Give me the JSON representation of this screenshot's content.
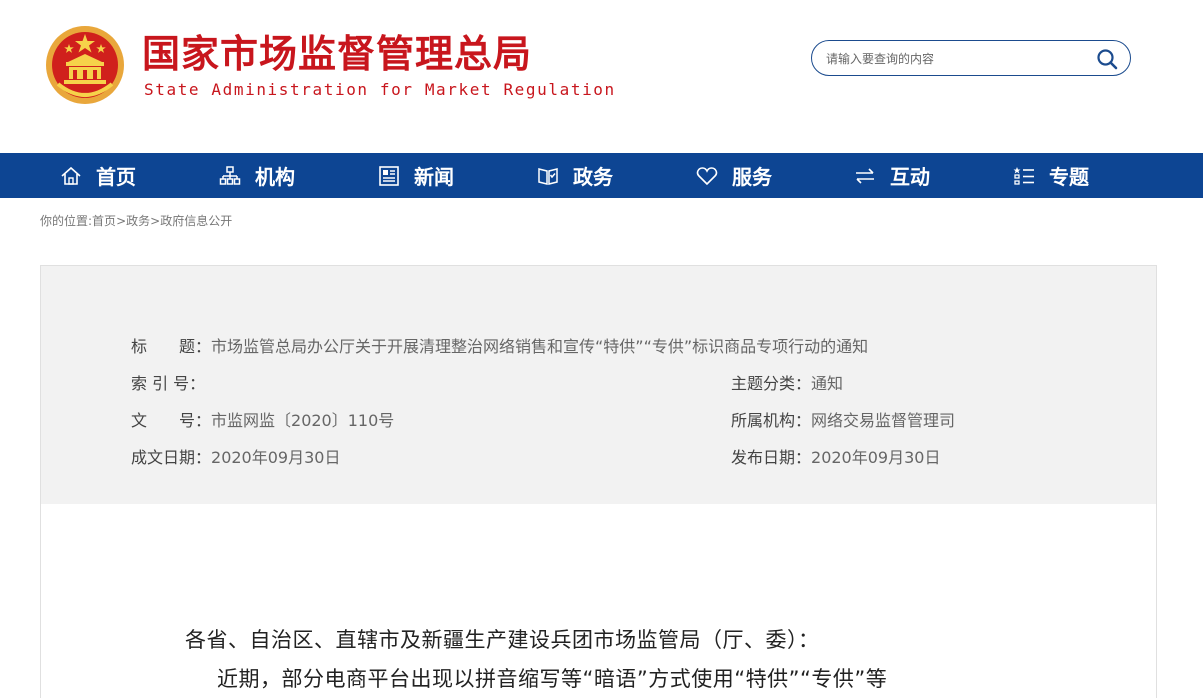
{
  "header": {
    "title": "国家市场监督管理总局",
    "subtitle": "State Administration for Market Regulation",
    "search_placeholder": "请输入要查询的内容"
  },
  "nav": {
    "items": [
      {
        "label": "首页",
        "icon": "home-icon"
      },
      {
        "label": "机构",
        "icon": "org-chart-icon"
      },
      {
        "label": "新闻",
        "icon": "news-icon"
      },
      {
        "label": "政务",
        "icon": "open-book-icon"
      },
      {
        "label": "服务",
        "icon": "heart-icon"
      },
      {
        "label": "互动",
        "icon": "exchange-arrows-icon"
      },
      {
        "label": "专题",
        "icon": "list-icon"
      }
    ]
  },
  "breadcrumb": {
    "prefix": "你的位置:",
    "items": [
      "首页",
      "政务",
      "政府信息公开"
    ],
    "separator": ">"
  },
  "info": {
    "title_label": "标　　题：",
    "title_value": "市场监管总局办公厅关于开展清理整治网络销售和宣传“特供”“专供”标识商品专项行动的通知",
    "index_label": "索 引 号：",
    "index_value": "",
    "topic_label": "主题分类：",
    "topic_value": "通知",
    "docno_label": "文　　号：",
    "docno_value": "市监网监〔2020〕110号",
    "org_label": "所属机构：",
    "org_value": "网络交易监督管理司",
    "created_label": "成文日期：",
    "created_value": "2020年09月30日",
    "published_label": "发布日期：",
    "published_value": "2020年09月30日"
  },
  "article": {
    "salutation": "各省、自治区、直辖市及新疆生产建设兵团市场监管局（厅、委）：",
    "paragraph_start": "近期，部分电商平台出现以拼音缩写等“暗语”方式使用“特供”“专供”等"
  },
  "colors": {
    "brand_red": "#c8161d",
    "nav_blue": "#0d4593",
    "panel_gray": "#f2f2f2"
  }
}
